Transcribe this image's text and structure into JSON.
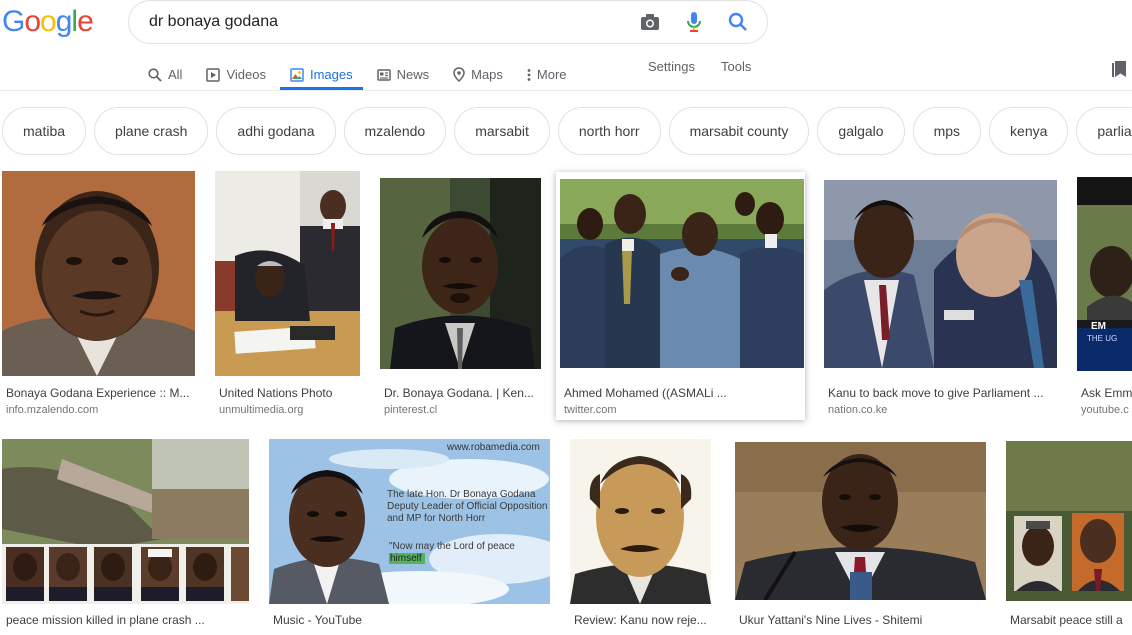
{
  "logo": {
    "letters": [
      "G",
      "o",
      "o",
      "g",
      "l",
      "e"
    ],
    "colors": [
      "#4285f4",
      "#ea4335",
      "#fbbc05",
      "#4285f4",
      "#34a853",
      "#ea4335"
    ]
  },
  "search": {
    "query": "dr bonaya godana"
  },
  "nav": {
    "tabs": [
      {
        "label": "All",
        "icon": "search-icon"
      },
      {
        "label": "Videos",
        "icon": "video-icon"
      },
      {
        "label": "Images",
        "icon": "image-icon",
        "active": true
      },
      {
        "label": "News",
        "icon": "news-icon"
      },
      {
        "label": "Maps",
        "icon": "map-pin-icon"
      },
      {
        "label": "More",
        "icon": "more-vert-icon"
      }
    ],
    "settings": "Settings",
    "tools": "Tools"
  },
  "chips": [
    "matiba",
    "plane crash",
    "adhi godana",
    "mzalendo",
    "marsabit",
    "north horr",
    "marsabit county",
    "galgalo",
    "mps",
    "kenya",
    "parlia"
  ],
  "results_row1": [
    {
      "title": "Bonaya Godana Experience :: M...",
      "source": "info.mzalendo.com"
    },
    {
      "title": "United Nations Photo",
      "source": "unmultimedia.org"
    },
    {
      "title": "Dr. Bonaya Godana. | Ken...",
      "source": "pinterest.cl"
    },
    {
      "title": "Ahmed Mohamed ((ASMALi ...",
      "source": "twitter.com"
    },
    {
      "title": "Kanu to back move to give Parliament ...",
      "source": "nation.co.ke"
    },
    {
      "title": "Ask Emm",
      "source": "youtube.c"
    }
  ],
  "results_row2": [
    {
      "title": "peace mission killed in plane crash ...",
      "source": ""
    },
    {
      "title": "Music - YouTube",
      "source": ""
    },
    {
      "title": "Review: Kanu now reje...",
      "source": ""
    },
    {
      "title": "Ukur Yattani's Nine Lives - Shitemi",
      "source": ""
    },
    {
      "title": "Marsabit peace still a",
      "source": ""
    }
  ],
  "overlay_text": {
    "robamedia_url": "www.robamedia.com",
    "robamedia_caption": "The late Hon. Dr Bonaya Godana Deputy Leader of Official Opposition and MP for North Horr",
    "robamedia_quote": "\"Now may the Lord of peace",
    "robamedia_quote2": "himself",
    "youtube_thumb_text": "EM",
    "youtube_thumb_text2": "THE UG"
  }
}
